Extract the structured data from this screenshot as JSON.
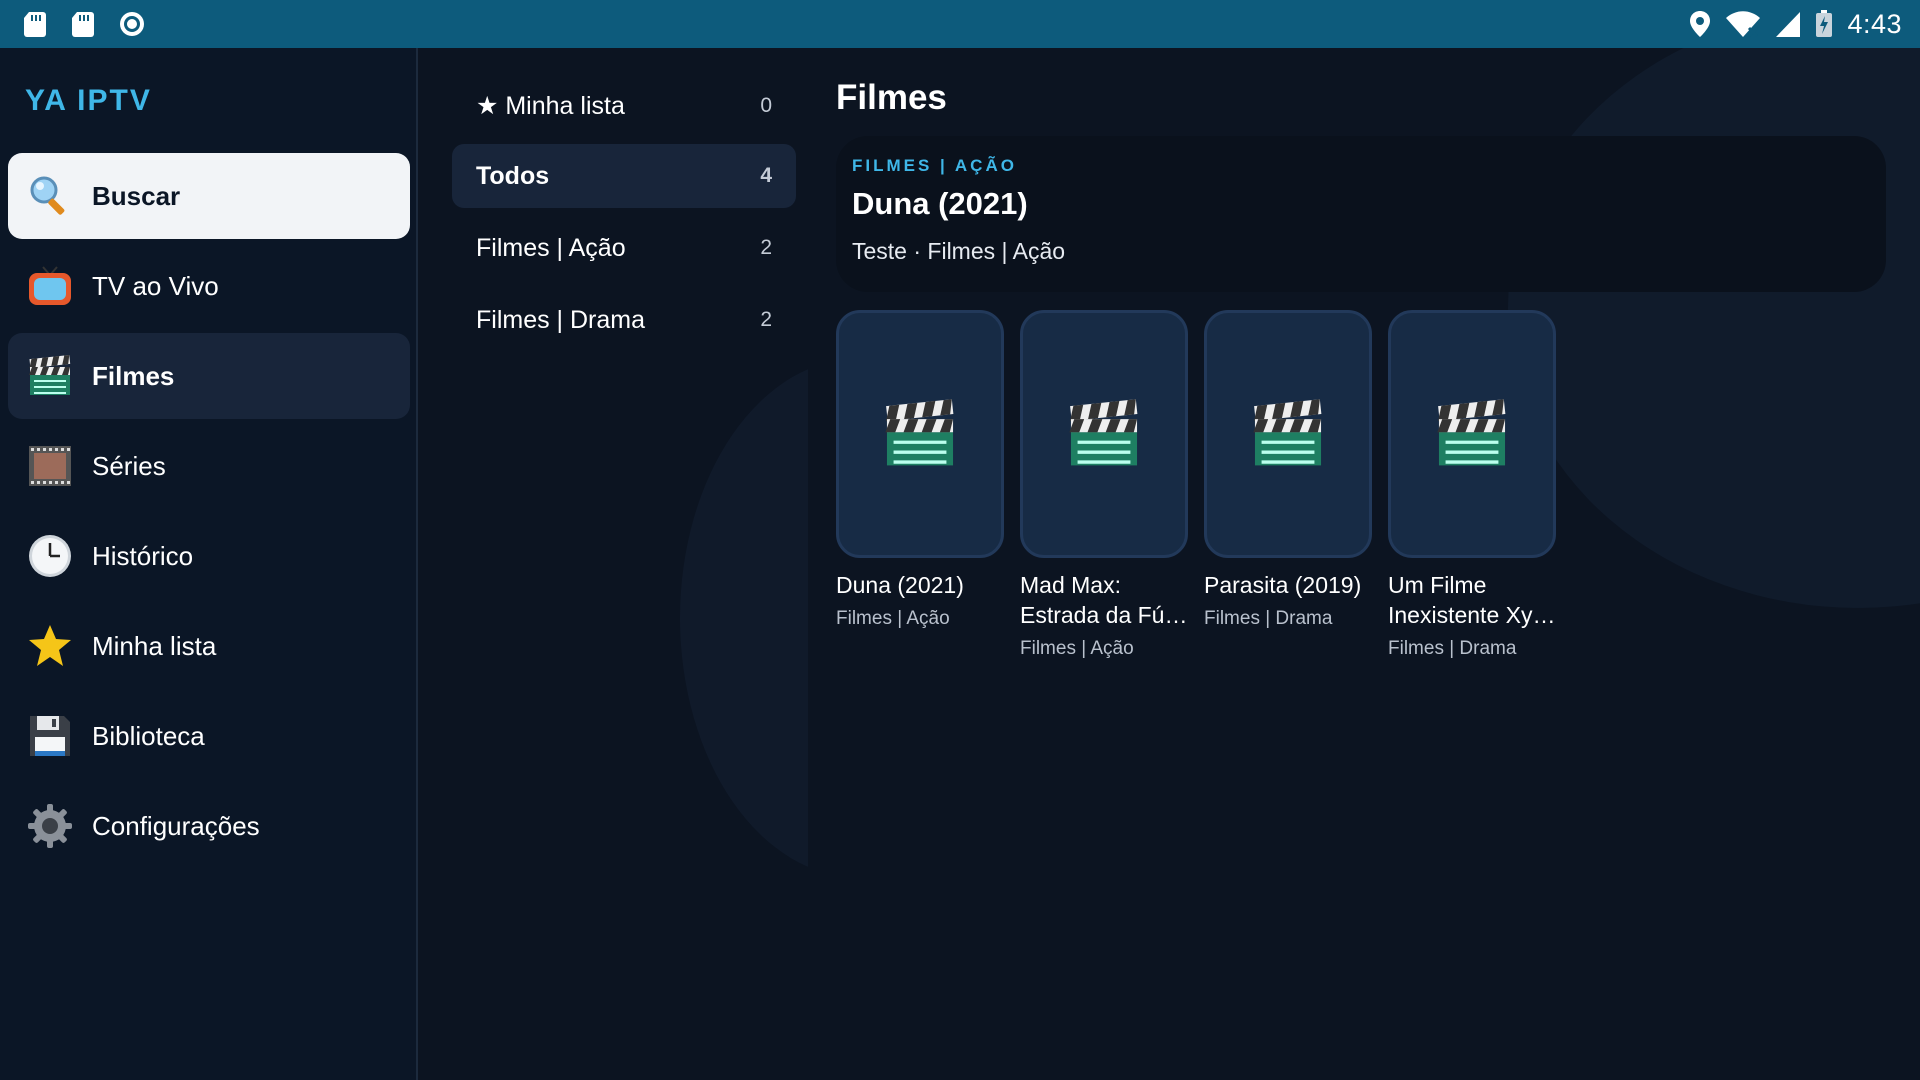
{
  "statusbar": {
    "time": "4:43",
    "left_icons": [
      "sd-card-icon",
      "sd-card-icon",
      "sync-circle-icon"
    ],
    "right_icons": [
      "location-pin-icon",
      "wifi-icon",
      "cell-signal-icon",
      "battery-charging-icon"
    ]
  },
  "sidebar": {
    "brand": "YA IPTV",
    "items": [
      {
        "label": "Buscar",
        "icon": "magnifier-icon"
      },
      {
        "label": "TV ao Vivo",
        "icon": "tv-icon"
      },
      {
        "label": "Filmes",
        "icon": "clapperboard-icon"
      },
      {
        "label": "Séries",
        "icon": "film-strip-icon"
      },
      {
        "label": "Histórico",
        "icon": "clock-icon"
      },
      {
        "label": "Minha lista",
        "icon": "star-icon"
      },
      {
        "label": "Biblioteca",
        "icon": "floppy-disk-icon"
      },
      {
        "label": "Configurações",
        "icon": "gear-icon"
      }
    ]
  },
  "categories": [
    {
      "label": "★ Minha lista",
      "count": "0"
    },
    {
      "label": "Todos",
      "count": "4"
    },
    {
      "label": "Filmes | Ação",
      "count": "2"
    },
    {
      "label": "Filmes | Drama",
      "count": "2"
    }
  ],
  "main": {
    "title": "Filmes",
    "featured": {
      "category": "FILMES | AÇÃO",
      "title": "Duna (2021)",
      "subtitle": "Teste · Filmes | Ação"
    },
    "movies": [
      {
        "title": "Duna (2021)",
        "category": "Filmes | Ação"
      },
      {
        "title": "Mad Max: Estrada da Fú…",
        "category": "Filmes | Ação"
      },
      {
        "title": "Parasita (2019)",
        "category": "Filmes | Drama"
      },
      {
        "title": "Um Filme Inexistente Xy…",
        "category": "Filmes | Drama"
      }
    ]
  },
  "colors": {
    "statusbar": "#0d5b7c",
    "background": "#0c1421",
    "accent": "#3fb7e8",
    "active_row": "#18253a",
    "poster": "#172b45"
  }
}
